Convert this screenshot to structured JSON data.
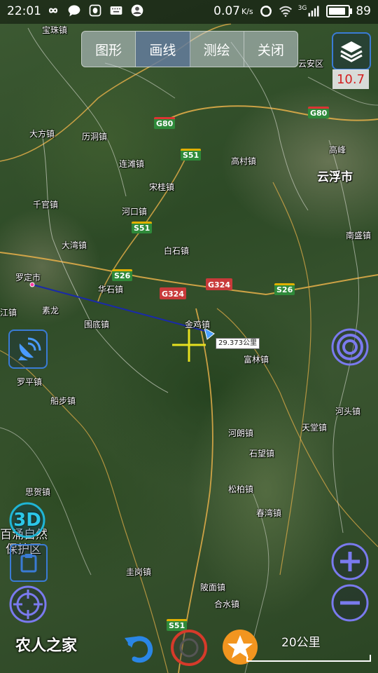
{
  "status_bar": {
    "time": "22:01",
    "net_speed": "0.07",
    "net_unit": "K/s",
    "signal_label": "3G",
    "battery": "89",
    "battery_fraction": 0.89
  },
  "toolbar": {
    "tabs": [
      {
        "label": "图形",
        "active": false
      },
      {
        "label": "画线",
        "active": true
      },
      {
        "label": "测绘",
        "active": false
      },
      {
        "label": "关闭",
        "active": false
      }
    ]
  },
  "layers": {
    "icon": "layers-icon",
    "zoom_level": "10.7"
  },
  "map": {
    "towns": [
      {
        "name": "宝珠镇",
        "cls": ""
      },
      {
        "name": "云安区",
        "cls": ""
      },
      {
        "name": "大方镇",
        "cls": ""
      },
      {
        "name": "历洞镇",
        "cls": ""
      },
      {
        "name": "连滩镇",
        "cls": ""
      },
      {
        "name": "高村镇",
        "cls": ""
      },
      {
        "name": "高峰",
        "cls": ""
      },
      {
        "name": "云浮市",
        "cls": "big"
      },
      {
        "name": "宋桂镇",
        "cls": ""
      },
      {
        "name": "千官镇",
        "cls": ""
      },
      {
        "name": "河口镇",
        "cls": ""
      },
      {
        "name": "南盛镇",
        "cls": ""
      },
      {
        "name": "大湾镇",
        "cls": ""
      },
      {
        "name": "白石镇",
        "cls": ""
      },
      {
        "name": "罗定市",
        "cls": ""
      },
      {
        "name": "华石镇",
        "cls": ""
      },
      {
        "name": "素龙",
        "cls": ""
      },
      {
        "name": "江镇",
        "cls": ""
      },
      {
        "name": "围底镇",
        "cls": ""
      },
      {
        "name": "金鸡镇",
        "cls": ""
      },
      {
        "name": "富林镇",
        "cls": ""
      },
      {
        "name": "罗平镇",
        "cls": ""
      },
      {
        "name": "船步镇",
        "cls": ""
      },
      {
        "name": "河头镇",
        "cls": ""
      },
      {
        "name": "天堂镇",
        "cls": ""
      },
      {
        "name": "河朗镇",
        "cls": ""
      },
      {
        "name": "石望镇",
        "cls": ""
      },
      {
        "name": "思贺镇",
        "cls": ""
      },
      {
        "name": "松柏镇",
        "cls": ""
      },
      {
        "name": "春湾镇",
        "cls": ""
      },
      {
        "name": "百涌自然",
        "cls": "poi"
      },
      {
        "name": "保护区",
        "cls": "poi"
      },
      {
        "name": "圭岗镇",
        "cls": ""
      },
      {
        "name": "陂面镇",
        "cls": ""
      },
      {
        "name": "合水镇",
        "cls": ""
      }
    ],
    "shields": [
      {
        "code": "G80",
        "cls": "g80"
      },
      {
        "code": "G80",
        "cls": "g80"
      },
      {
        "code": "S51",
        "cls": "green"
      },
      {
        "code": "S51",
        "cls": "green"
      },
      {
        "code": "S26",
        "cls": "green"
      },
      {
        "code": "G324",
        "cls": "red"
      },
      {
        "code": "G324",
        "cls": "red"
      },
      {
        "code": "S26",
        "cls": "green"
      },
      {
        "code": "S51",
        "cls": "green"
      }
    ],
    "measure_label": "29.373公里"
  },
  "controls": {
    "compass_icon": "satellite-dish-icon",
    "target_icon": "target-circle-icon",
    "three_d_label": "3D",
    "crosshair_icon": "locate-crosshair-icon",
    "zoom_in_icon": "plus-icon",
    "zoom_out_icon": "minus-icon",
    "undo_icon": "undo-arrow-icon",
    "record_icon": "record-icon",
    "favorite_icon": "star-icon"
  },
  "scale": {
    "label": "20公里"
  },
  "watermark": {
    "text": "农人之家"
  }
}
